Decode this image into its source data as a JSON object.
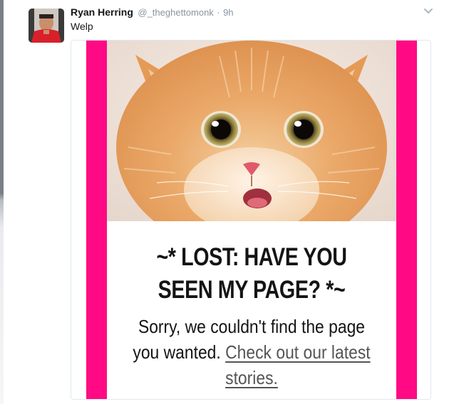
{
  "tweet": {
    "author_name": "Ryan Herring",
    "handle": "@_theghettomonk",
    "separator": "·",
    "time": "9h",
    "text": "Welp",
    "caret_icon": "chevron-down-icon"
  },
  "card": {
    "title": "~* LOST: HAVE YOU SEEN MY PAGE? *~",
    "body_text": "Sorry, we couldn't find the page you wanted.",
    "link_text": "Check out our latest stories.",
    "colors": {
      "border_pink": "#ff0a84",
      "text": "#141414"
    }
  }
}
